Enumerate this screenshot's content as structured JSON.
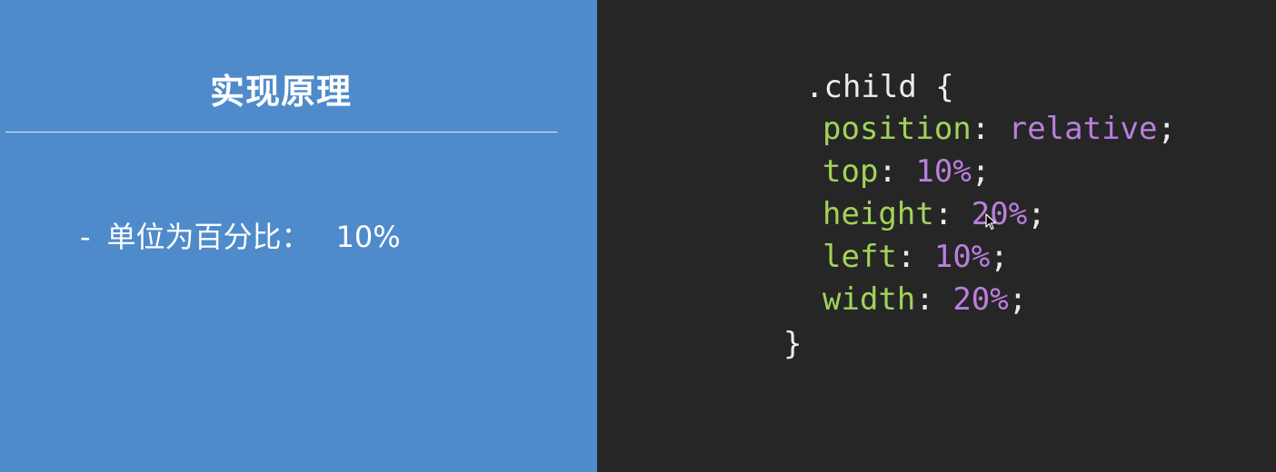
{
  "slide": {
    "title": "实现原理",
    "bullet": {
      "dash": "-",
      "label": "单位为百分比：",
      "value": "10%"
    }
  },
  "code": {
    "selector": ".child {",
    "closing": "}",
    "declarations": [
      {
        "property": "position",
        "value": "relative"
      },
      {
        "property": "top",
        "value": "10%"
      },
      {
        "property": "height",
        "value": "20%"
      },
      {
        "property": "left",
        "value": "10%"
      },
      {
        "property": "width",
        "value": "20%"
      }
    ],
    "colon": ":",
    "semicolon": ";"
  },
  "colors": {
    "slide_background": "#4f8bcb",
    "editor_background": "#262626",
    "property_color": "#a2d35a",
    "value_color": "#bb7ede",
    "text_color": "#ececec"
  },
  "icons": {
    "cursor": "mouse-pointer-icon"
  }
}
